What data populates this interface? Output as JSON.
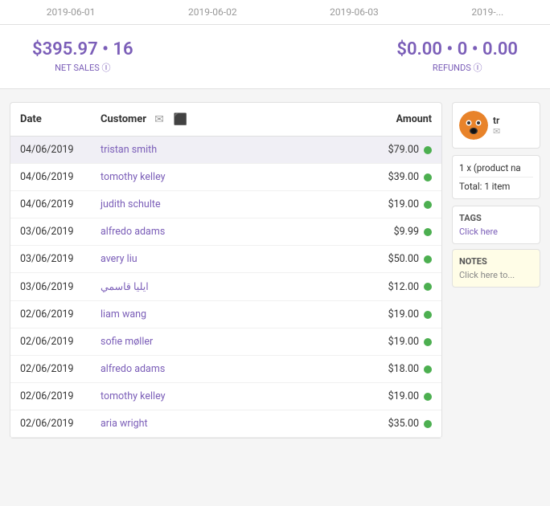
{
  "topbar": {
    "dates": [
      "2019-06-01",
      "2019-06-02",
      "2019-06-03",
      "2019-..."
    ]
  },
  "summary": {
    "net_sales_amount": "$395.97",
    "net_sales_count": "16",
    "net_sales_label": "NET SALES",
    "refunds_amount": "$0.00",
    "refunds_count": "0",
    "refunds_extra": "0.00",
    "refunds_label": "REFUNDS"
  },
  "table": {
    "col_date": "Date",
    "col_customer": "Customer",
    "col_amount": "Amount",
    "rows": [
      {
        "date": "04/06/2019",
        "name": "tristan smith",
        "amount": "$79.00",
        "selected": true
      },
      {
        "date": "04/06/2019",
        "name": "tomothy kelley",
        "amount": "$39.00",
        "selected": false
      },
      {
        "date": "04/06/2019",
        "name": "judith schulte",
        "amount": "$19.00",
        "selected": false
      },
      {
        "date": "03/06/2019",
        "name": "alfredo adams",
        "amount": "$9.99",
        "selected": false
      },
      {
        "date": "03/06/2019",
        "name": "avery liu",
        "amount": "$50.00",
        "selected": false
      },
      {
        "date": "03/06/2019",
        "name": "ايليا قاسمي",
        "amount": "$12.00",
        "selected": false
      },
      {
        "date": "02/06/2019",
        "name": "liam wang",
        "amount": "$19.00",
        "selected": false
      },
      {
        "date": "02/06/2019",
        "name": "sofie møller",
        "amount": "$19.00",
        "selected": false
      },
      {
        "date": "02/06/2019",
        "name": "alfredo adams",
        "amount": "$18.00",
        "selected": false
      },
      {
        "date": "02/06/2019",
        "name": "tomothy kelley",
        "amount": "$19.00",
        "selected": false
      },
      {
        "date": "02/06/2019",
        "name": "aria wright",
        "amount": "$35.00",
        "selected": false
      }
    ]
  },
  "right_panel": {
    "customer_name": "tr",
    "order_info": "1 x (product na",
    "order_total": "Total: 1 item",
    "tags_title": "TAGS",
    "tags_click": "Click here",
    "notes_title": "NOTES",
    "notes_click": "Click here to..."
  }
}
